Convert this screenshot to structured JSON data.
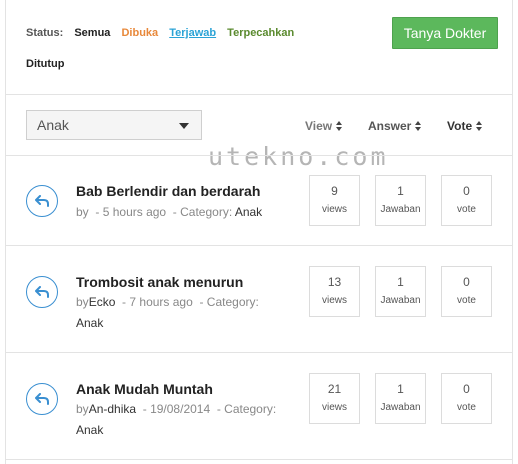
{
  "filters": {
    "label": "Status:",
    "items": [
      "Semua",
      "Dibuka",
      "Terjawab",
      "Terpecahkan",
      "Ditutup"
    ]
  },
  "ask_button": "Tanya Dokter",
  "category": {
    "selected": "Anak"
  },
  "sort": {
    "view": "View",
    "answer": "Answer",
    "vote": "Vote"
  },
  "watermark": "utekno.com",
  "questions": [
    {
      "title": "Bab Berlendir dan berdarah",
      "meta_by": "by",
      "author": "",
      "sep1": "-",
      "time": "5 hours ago",
      "sep2": "-",
      "category_label": "Category:",
      "category": "Anak",
      "views": "9",
      "views_label": "views",
      "answers": "1",
      "answers_label": "Jawaban",
      "votes": "0",
      "votes_label": "vote"
    },
    {
      "title": "Trombosit anak menurun",
      "meta_by": "by",
      "author": "Ecko",
      "sep1": "-",
      "time": "7 hours ago",
      "sep2": "-",
      "category_label": "Category:",
      "category": "Anak",
      "views": "13",
      "views_label": "views",
      "answers": "1",
      "answers_label": "Jawaban",
      "votes": "0",
      "votes_label": "vote"
    },
    {
      "title": "Anak Mudah Muntah",
      "meta_by": "by",
      "author": "An-dhika",
      "sep1": "-",
      "time": "19/08/2014",
      "sep2": "-",
      "category_label": "Category:",
      "category": "Anak",
      "views": "21",
      "views_label": "views",
      "answers": "1",
      "answers_label": "Jawaban",
      "votes": "0",
      "votes_label": "vote"
    }
  ],
  "colors": {
    "ask_button": "#5cb85c",
    "filter_open": "#e8883a",
    "filter_answered": "#2aa3d6",
    "filter_solved": "#5a8a2e",
    "reply_icon": "#3a8fd1"
  }
}
